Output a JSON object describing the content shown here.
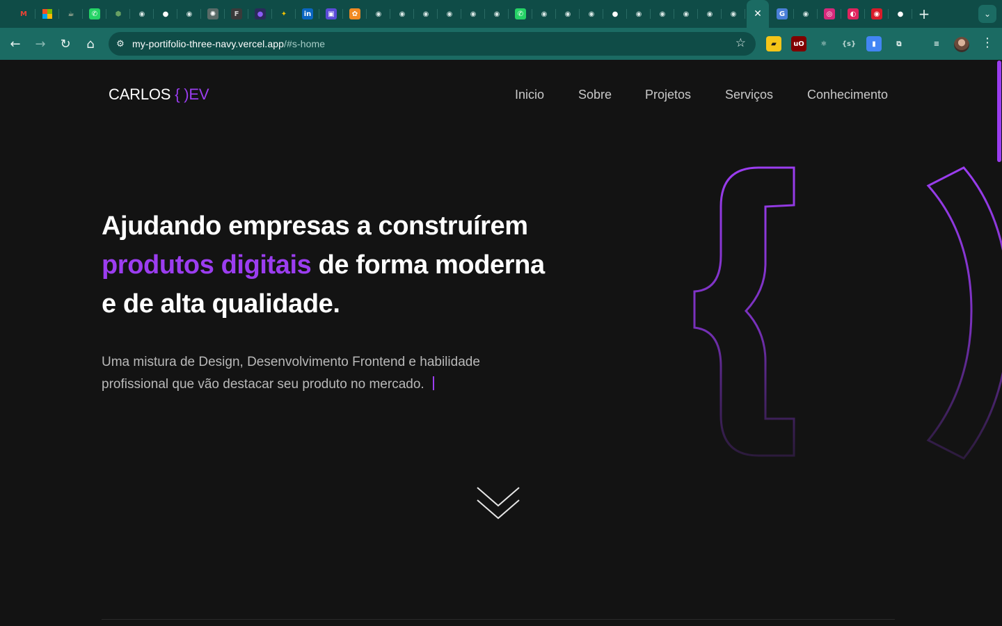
{
  "browser": {
    "tabs": [
      {
        "icon": "gmail-icon",
        "glyph": "M",
        "color": "#ea4335",
        "bg": "transparent"
      },
      {
        "icon": "microsoft-icon",
        "glyph": "",
        "color": "#ffffff",
        "bg": "ms"
      },
      {
        "icon": "coffee-icon",
        "glyph": "☕",
        "color": "#f0e0c0",
        "bg": "transparent"
      },
      {
        "icon": "whatsapp-icon",
        "glyph": "✆",
        "color": "#ffffff",
        "bg": "#25d366"
      },
      {
        "icon": "nodejs-icon",
        "glyph": "⬢",
        "color": "#68a063",
        "bg": "transparent"
      },
      {
        "icon": "globe-icon",
        "glyph": "◉",
        "color": "#d7e6e4",
        "bg": "transparent"
      },
      {
        "icon": "github-icon",
        "glyph": "●",
        "color": "#ffffff",
        "bg": "transparent"
      },
      {
        "icon": "globe-icon",
        "glyph": "◉",
        "color": "#d7e6e4",
        "bg": "transparent"
      },
      {
        "icon": "chatgpt-icon",
        "glyph": "✺",
        "color": "#ffffff",
        "bg": "#5a6b68"
      },
      {
        "icon": "figma-icon",
        "glyph": "F",
        "color": "#d0d0d0",
        "bg": "#3a3a3a"
      },
      {
        "icon": "app-circle-icon",
        "glyph": "●",
        "color": "#8a5cf5",
        "bg": "#2a2a5a"
      },
      {
        "icon": "spark-icon",
        "glyph": "✦",
        "color": "#f2c200",
        "bg": "transparent"
      },
      {
        "icon": "linkedin-icon",
        "glyph": "in",
        "color": "#ffffff",
        "bg": "#0a66c2"
      },
      {
        "icon": "app-purple-icon",
        "glyph": "▣",
        "color": "#ffffff",
        "bg": "#5b4bd8"
      },
      {
        "icon": "app-orange-icon",
        "glyph": "✿",
        "color": "#ffffff",
        "bg": "#f08a24"
      },
      {
        "icon": "globe-icon",
        "glyph": "◉",
        "color": "#d7e6e4",
        "bg": "transparent"
      },
      {
        "icon": "globe-icon",
        "glyph": "◉",
        "color": "#d7e6e4",
        "bg": "transparent"
      },
      {
        "icon": "globe-icon",
        "glyph": "◉",
        "color": "#d7e6e4",
        "bg": "transparent"
      },
      {
        "icon": "globe-icon",
        "glyph": "◉",
        "color": "#d7e6e4",
        "bg": "transparent"
      },
      {
        "icon": "globe-icon",
        "glyph": "◉",
        "color": "#d7e6e4",
        "bg": "transparent"
      },
      {
        "icon": "globe-icon",
        "glyph": "◉",
        "color": "#d7e6e4",
        "bg": "transparent"
      },
      {
        "icon": "whatsapp-icon",
        "glyph": "✆",
        "color": "#ffffff",
        "bg": "#25d366"
      },
      {
        "icon": "globe-icon",
        "glyph": "◉",
        "color": "#d7e6e4",
        "bg": "transparent"
      },
      {
        "icon": "globe-icon",
        "glyph": "◉",
        "color": "#d7e6e4",
        "bg": "transparent"
      },
      {
        "icon": "globe-icon",
        "glyph": "◉",
        "color": "#d7e6e4",
        "bg": "transparent"
      },
      {
        "icon": "github-icon",
        "glyph": "●",
        "color": "#ffffff",
        "bg": "transparent"
      },
      {
        "icon": "globe-icon",
        "glyph": "◉",
        "color": "#d7e6e4",
        "bg": "transparent"
      },
      {
        "icon": "globe-icon",
        "glyph": "◉",
        "color": "#d7e6e4",
        "bg": "transparent"
      },
      {
        "icon": "globe-icon",
        "glyph": "◉",
        "color": "#d7e6e4",
        "bg": "transparent"
      },
      {
        "icon": "globe-icon",
        "glyph": "◉",
        "color": "#d7e6e4",
        "bg": "transparent"
      },
      {
        "icon": "globe-icon",
        "glyph": "◉",
        "color": "#d7e6e4",
        "bg": "transparent"
      },
      {
        "icon": "close-icon",
        "glyph": "✕",
        "color": "#ffffff",
        "bg": "transparent",
        "active": true
      },
      {
        "icon": "google-translate-icon",
        "glyph": "G",
        "color": "#ffffff",
        "bg": "#4a7fd8"
      },
      {
        "icon": "globe-icon",
        "glyph": "◉",
        "color": "#d7e6e4",
        "bg": "transparent"
      },
      {
        "icon": "instagram-icon",
        "glyph": "◎",
        "color": "#ffffff",
        "bg": "#d6297b"
      },
      {
        "icon": "app-red-blue-icon",
        "glyph": "◐",
        "color": "#ffffff",
        "bg": "#e0245e"
      },
      {
        "icon": "app-red-icon",
        "glyph": "◉",
        "color": "#ffffff",
        "bg": "#d81b2a"
      },
      {
        "icon": "github-icon",
        "glyph": "●",
        "color": "#ffffff",
        "bg": "transparent"
      }
    ],
    "new_tab_glyph": "+",
    "tab_search_glyph": "⌄",
    "url_host": "my-portifolio-three-navy.vercel.app",
    "url_path": "/#s-home",
    "extensions": [
      {
        "icon": "folder-ext-icon",
        "glyph": "▰",
        "color": "#1b1b1b",
        "bg": "#f5c518"
      },
      {
        "icon": "ublock-icon",
        "glyph": "uO",
        "color": "#ffffff",
        "bg": "#800000"
      },
      {
        "icon": "react-devtools-icon",
        "glyph": "⚛",
        "color": "#e8f3f1",
        "bg": "transparent"
      },
      {
        "icon": "json-ext-icon",
        "glyph": "{s}",
        "color": "#c0d8d4",
        "bg": "transparent"
      },
      {
        "icon": "docs-ext-icon",
        "glyph": "▮",
        "color": "#ffffff",
        "bg": "#4285f4"
      },
      {
        "icon": "puzzle-icon",
        "glyph": "⧉",
        "color": "#e8f3f1",
        "bg": "transparent"
      },
      {
        "icon": "media-queue-icon",
        "glyph": "≡",
        "color": "#e8f3f1",
        "bg": "transparent"
      }
    ]
  },
  "site": {
    "logo_main": "CARLOS",
    "logo_accent": "{ )EV",
    "nav": [
      "Inicio",
      "Sobre",
      "Projetos",
      "Serviços",
      "Conhecimento"
    ],
    "headline_line1": "Ajudando empresas a construírem",
    "headline_highlight": "produtos digitais",
    "headline_line2_rest": " de forma moderna",
    "headline_line3": "e de alta qualidade.",
    "subtitle_line1": "Uma mistura de Design, Desenvolvimento Frontend e habilidade",
    "subtitle_line2": "profissional que vão destacar seu produto no mercado.",
    "accent_color": "#9b3df0",
    "background_color": "#131313"
  }
}
